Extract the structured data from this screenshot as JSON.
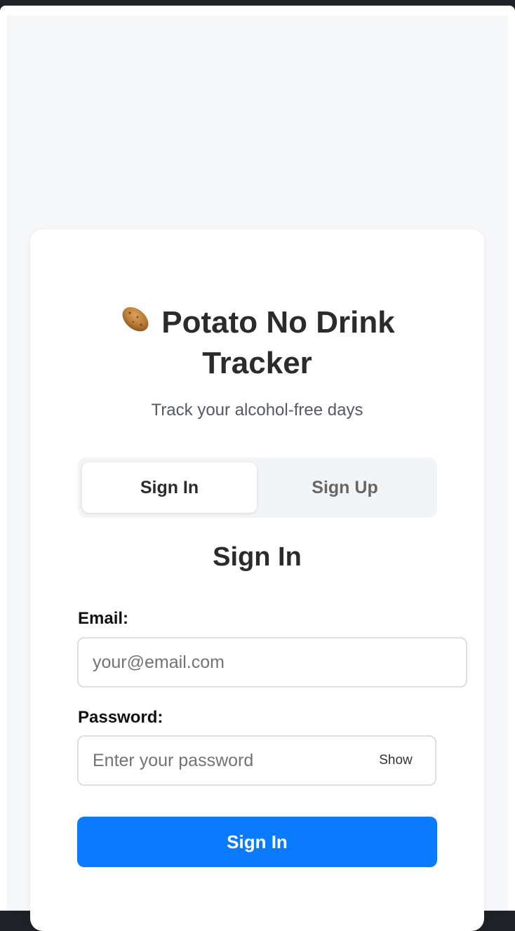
{
  "app": {
    "icon": "potato-icon",
    "title": "Potato No Drink Tracker",
    "subtitle": "Track your alcohol-free days"
  },
  "tabs": [
    {
      "label": "Sign In",
      "active": true
    },
    {
      "label": "Sign Up",
      "active": false
    }
  ],
  "form": {
    "heading": "Sign In",
    "email_label": "Email:",
    "email_placeholder": "your@email.com",
    "email_value": "",
    "password_label": "Password:",
    "password_placeholder": "Enter your password",
    "password_value": "",
    "show_label": "Show",
    "submit_label": "Sign In"
  },
  "colors": {
    "primary": "#0a7bff",
    "page_background": "#f6f7f9",
    "card_background": "#ffffff",
    "tab_track": "#f3f4f6"
  }
}
